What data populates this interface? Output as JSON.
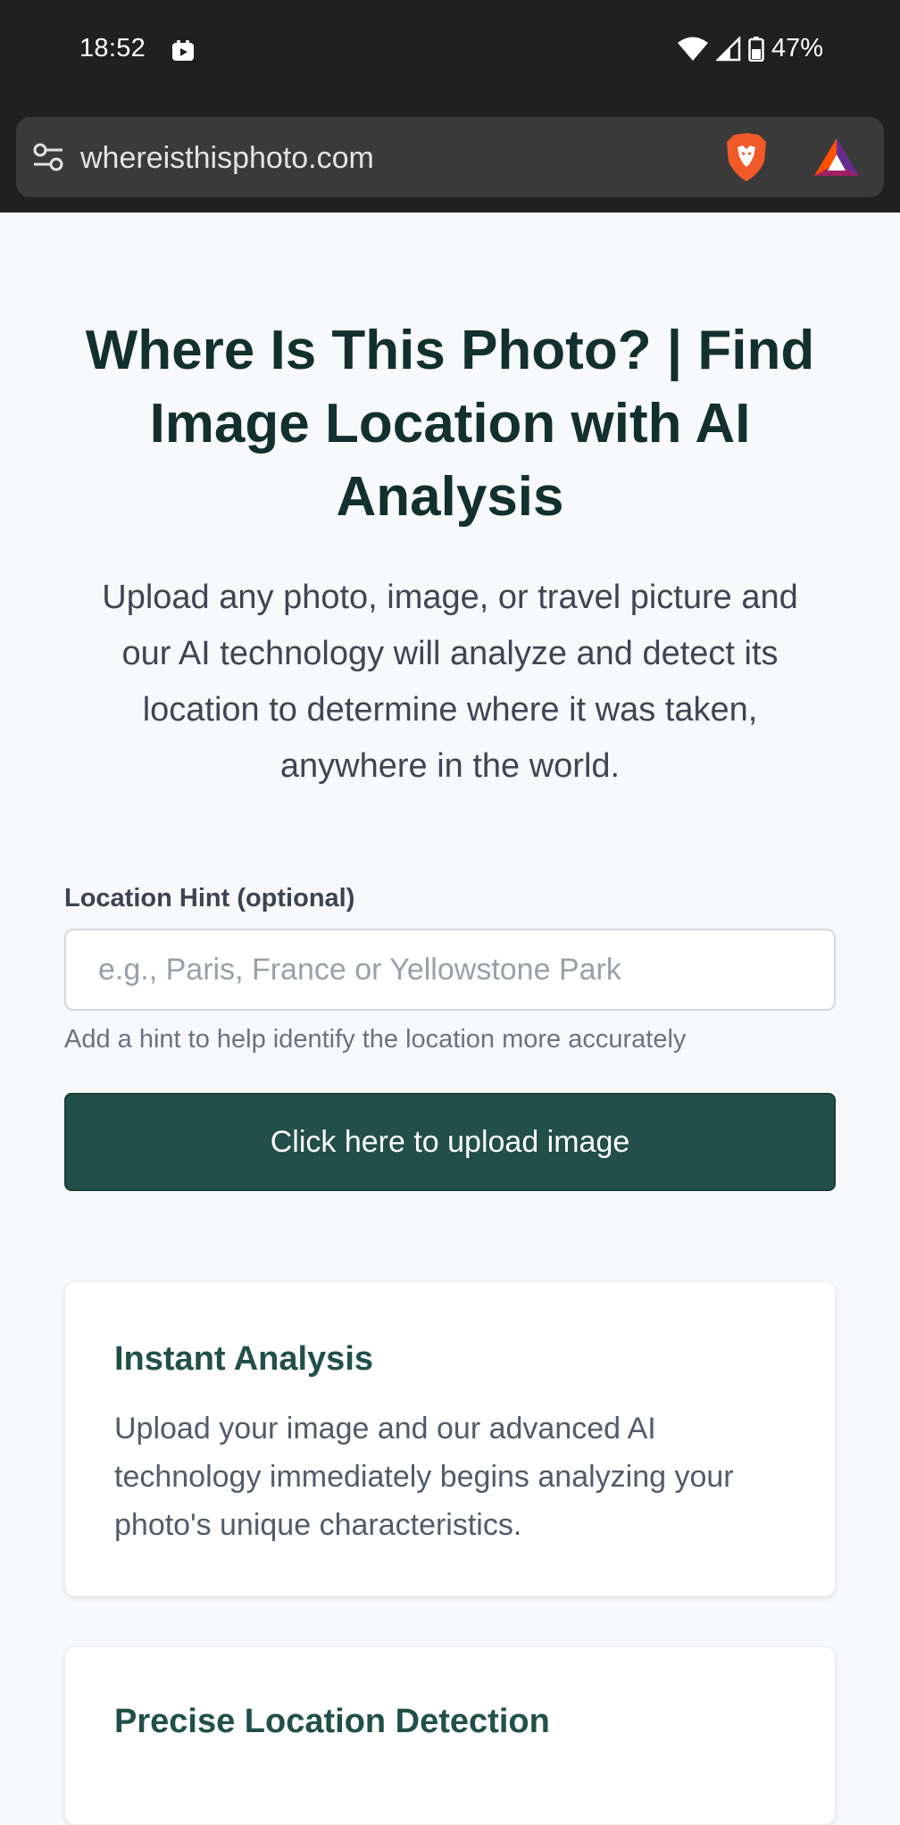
{
  "status_bar": {
    "time": "18:52",
    "battery": "47%",
    "icons": [
      "notification-icon",
      "wifi-icon",
      "signal-icon",
      "battery-icon"
    ]
  },
  "browser": {
    "url": "whereisthisphoto.com",
    "icons": [
      "site-settings-icon",
      "brave-shields-icon",
      "brave-rewards-icon"
    ]
  },
  "page": {
    "title": "Where Is This Photo? | Find Image Location with AI Analysis",
    "subtitle": "Upload any photo, image, or travel picture and our AI technology will analyze and detect its location to determine where it was taken, anywhere in the world.",
    "hint": {
      "label": "Location Hint (optional)",
      "placeholder": "e.g., Paris, France or Yellowstone Park",
      "value": "",
      "help": "Add a hint to help identify the location more accurately"
    },
    "upload_label": "Click here to upload image",
    "features": [
      {
        "title": "Instant Analysis",
        "text": "Upload your image and our advanced AI technology immediately begins analyzing your photo's unique characteristics."
      },
      {
        "title": "Precise Location Detection",
        "text": ""
      }
    ]
  },
  "colors": {
    "status_bar_bg": "#202020",
    "page_bg": "#f8f9fb",
    "heading": "#12302e",
    "accent": "#224f4a",
    "card_title": "#21504b"
  }
}
